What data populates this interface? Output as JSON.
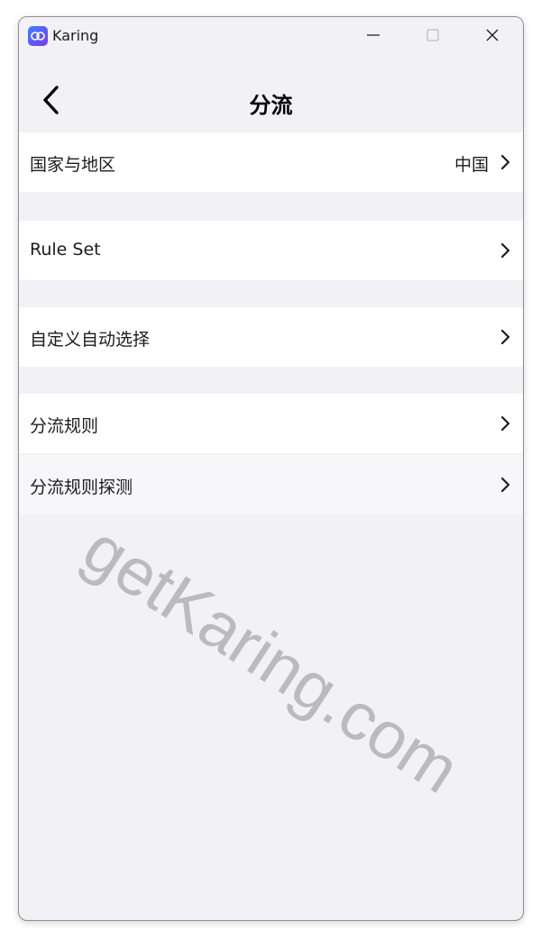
{
  "window": {
    "app_name": "Karing",
    "controls": [
      "minimize",
      "maximize",
      "close"
    ]
  },
  "header": {
    "title": "分流"
  },
  "rows": [
    {
      "label": "国家与地区",
      "value": "中国"
    },
    {
      "label": "Rule Set",
      "value": ""
    },
    {
      "label": "自定义自动选择",
      "value": ""
    },
    {
      "label": "分流规则",
      "value": ""
    },
    {
      "label": "分流规则探测",
      "value": ""
    }
  ],
  "watermark": "getKaring.com",
  "colors": {
    "background": "#f2f1f6",
    "row_background": "#ffffff",
    "row_alt_background": "#f7f7f9",
    "icon_gradient_start": "#3b82f6",
    "icon_gradient_end": "#7c3aed",
    "watermark": "#8a8a8a"
  }
}
